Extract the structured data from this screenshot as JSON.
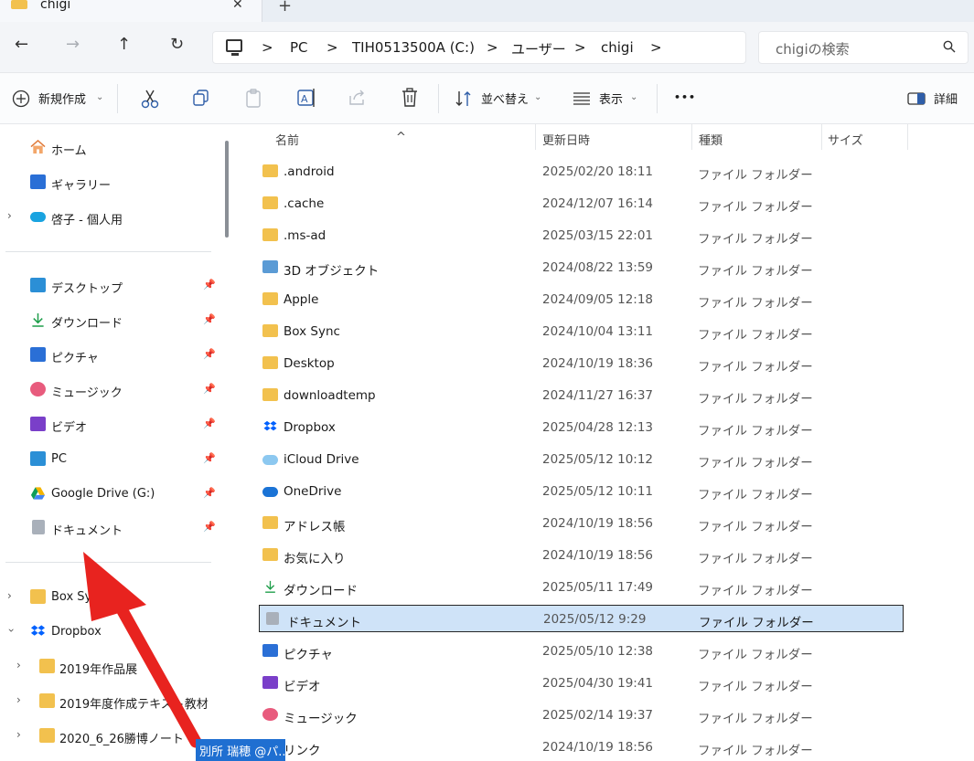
{
  "window": {
    "tab_title": "chigi",
    "tab_close": "✕",
    "new_tab": "+"
  },
  "nav": {
    "back": "←",
    "forward": "→",
    "up": "↑",
    "refresh": "↻"
  },
  "breadcrumb": {
    "sep": ">",
    "items": [
      "PC",
      "TIH0513500A (C:)",
      "ユーザー",
      "chigi"
    ]
  },
  "search": {
    "placeholder": "chigiの検索",
    "icon": "search-icon"
  },
  "toolbar": {
    "new_label": "新規作成",
    "sort_label": "並べ替え",
    "view_label": "表示",
    "more_label": "•••",
    "details_label": "詳細"
  },
  "sidebar": {
    "home": "ホーム",
    "gallery": "ギャラリー",
    "onedrive": "啓子 - 個人用",
    "quick": [
      {
        "label": "デスクトップ"
      },
      {
        "label": "ダウンロード"
      },
      {
        "label": "ピクチャ"
      },
      {
        "label": "ミュージック"
      },
      {
        "label": "ビデオ"
      },
      {
        "label": "PC"
      },
      {
        "label": "Google Drive (G:)"
      },
      {
        "label": "ドキュメント"
      }
    ],
    "tree": [
      {
        "label": "Box Sync"
      },
      {
        "label": "Dropbox"
      },
      {
        "label": "2019年作品展"
      },
      {
        "label": "2019年度作成テキスト教材"
      },
      {
        "label": "2020_6_26勝博ノート"
      }
    ]
  },
  "columns": {
    "name": "名前",
    "date": "更新日時",
    "type": "種類",
    "size": "サイズ"
  },
  "files": [
    {
      "name": ".android",
      "date": "2025/02/20 18:11",
      "type": "ファイル フォルダー"
    },
    {
      "name": ".cache",
      "date": "2024/12/07 16:14",
      "type": "ファイル フォルダー"
    },
    {
      "name": ".ms-ad",
      "date": "2025/03/15 22:01",
      "type": "ファイル フォルダー"
    },
    {
      "name": "3D オブジェクト",
      "date": "2024/08/22 13:59",
      "type": "ファイル フォルダー"
    },
    {
      "name": "Apple",
      "date": "2024/09/05 12:18",
      "type": "ファイル フォルダー"
    },
    {
      "name": "Box Sync",
      "date": "2024/10/04 13:11",
      "type": "ファイル フォルダー"
    },
    {
      "name": "Desktop",
      "date": "2024/10/19 18:36",
      "type": "ファイル フォルダー"
    },
    {
      "name": "downloadtemp",
      "date": "2024/11/27 16:37",
      "type": "ファイル フォルダー"
    },
    {
      "name": "Dropbox",
      "date": "2025/04/28 12:13",
      "type": "ファイル フォルダー"
    },
    {
      "name": "iCloud Drive",
      "date": "2025/05/12 10:12",
      "type": "ファイル フォルダー"
    },
    {
      "name": "OneDrive",
      "date": "2025/05/12 10:11",
      "type": "ファイル フォルダー"
    },
    {
      "name": "アドレス帳",
      "date": "2024/10/19 18:56",
      "type": "ファイル フォルダー"
    },
    {
      "name": "お気に入り",
      "date": "2024/10/19 18:56",
      "type": "ファイル フォルダー"
    },
    {
      "name": "ダウンロード",
      "date": "2025/05/11 17:49",
      "type": "ファイル フォルダー"
    },
    {
      "name": "ドキュメント",
      "date": "2025/05/12 9:29",
      "type": "ファイル フォルダー"
    },
    {
      "name": "ピクチャ",
      "date": "2025/05/10 12:38",
      "type": "ファイル フォルダー"
    },
    {
      "name": "ビデオ",
      "date": "2025/04/30 19:41",
      "type": "ファイル フォルダー"
    },
    {
      "name": "ミュージック",
      "date": "2025/02/14 19:37",
      "type": "ファイル フォルダー"
    },
    {
      "name": "リンク",
      "date": "2024/10/19 18:56",
      "type": "ファイル フォルダー"
    }
  ],
  "overlay": {
    "user_label": "別所 瑞穂 @パ..."
  },
  "colors": {
    "accent": "#1f6fd1",
    "selected_row": "#cfe3f8",
    "folder": "#f2c14e",
    "arrow": "#e8231f"
  }
}
